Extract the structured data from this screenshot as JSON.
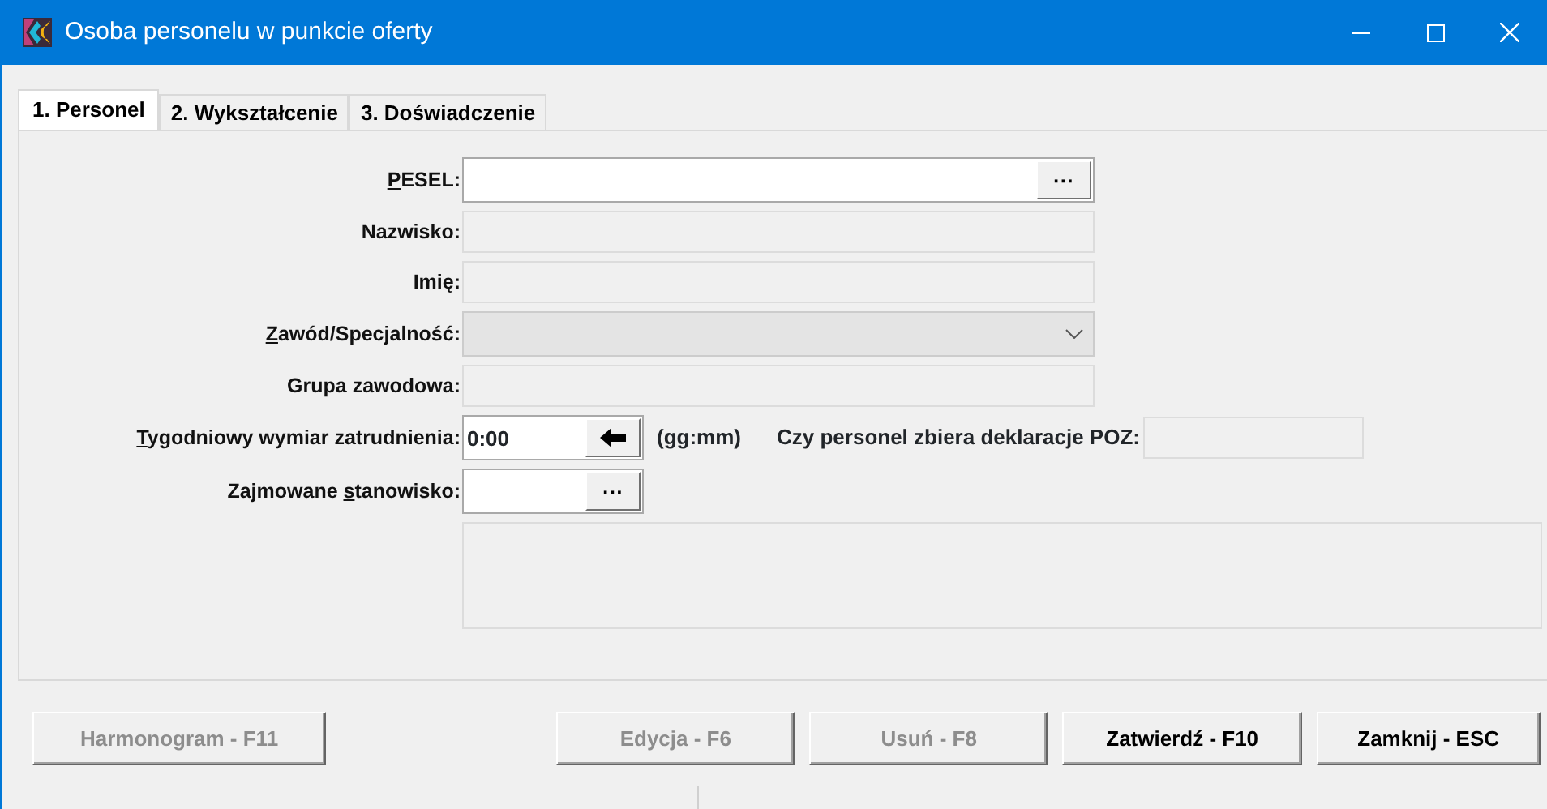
{
  "window": {
    "title": "Osoba personelu w punkcie oferty"
  },
  "tabs": [
    {
      "label": "1. Personel",
      "selected": true
    },
    {
      "label": "2. Wykształcenie",
      "selected": false
    },
    {
      "label": "3. Doświadczenie",
      "selected": false
    }
  ],
  "fields": [
    {
      "kind": "lookup",
      "label": {
        "accel": "P",
        "after": "ESEL:"
      },
      "button": "···"
    },
    {
      "kind": "readonly",
      "label": {
        "before": "Nazwisko:"
      }
    },
    {
      "kind": "readonly",
      "label": {
        "before": "Imię:"
      }
    },
    {
      "kind": "combo",
      "label": {
        "accel": "Z",
        "after": "awód/Specjalność:"
      }
    },
    {
      "kind": "readonly",
      "label": {
        "before": "Grupa zawodowa:"
      }
    },
    {
      "kind": "time",
      "label": {
        "accel": "T",
        "after": "ygodniowy wymiar zatrudnienia:"
      },
      "value": "0:00",
      "hint": "(gg:mm)",
      "extra_label": "Czy personel zbiera deklaracje POZ:"
    },
    {
      "kind": "short_lookup",
      "label": {
        "before": "Zajmowane ",
        "accel": "s",
        "after": "tanowisko:"
      },
      "button": "···"
    }
  ],
  "buttons": [
    {
      "label": "Harmonogram - F11",
      "disabled": true
    },
    {
      "label": "Edycja - F6",
      "disabled": true
    },
    {
      "label": "Usuń - F8",
      "disabled": true
    },
    {
      "label": "Zatwierdź - F10",
      "disabled": false
    },
    {
      "label": "Zamknij - ESC",
      "disabled": false
    }
  ]
}
